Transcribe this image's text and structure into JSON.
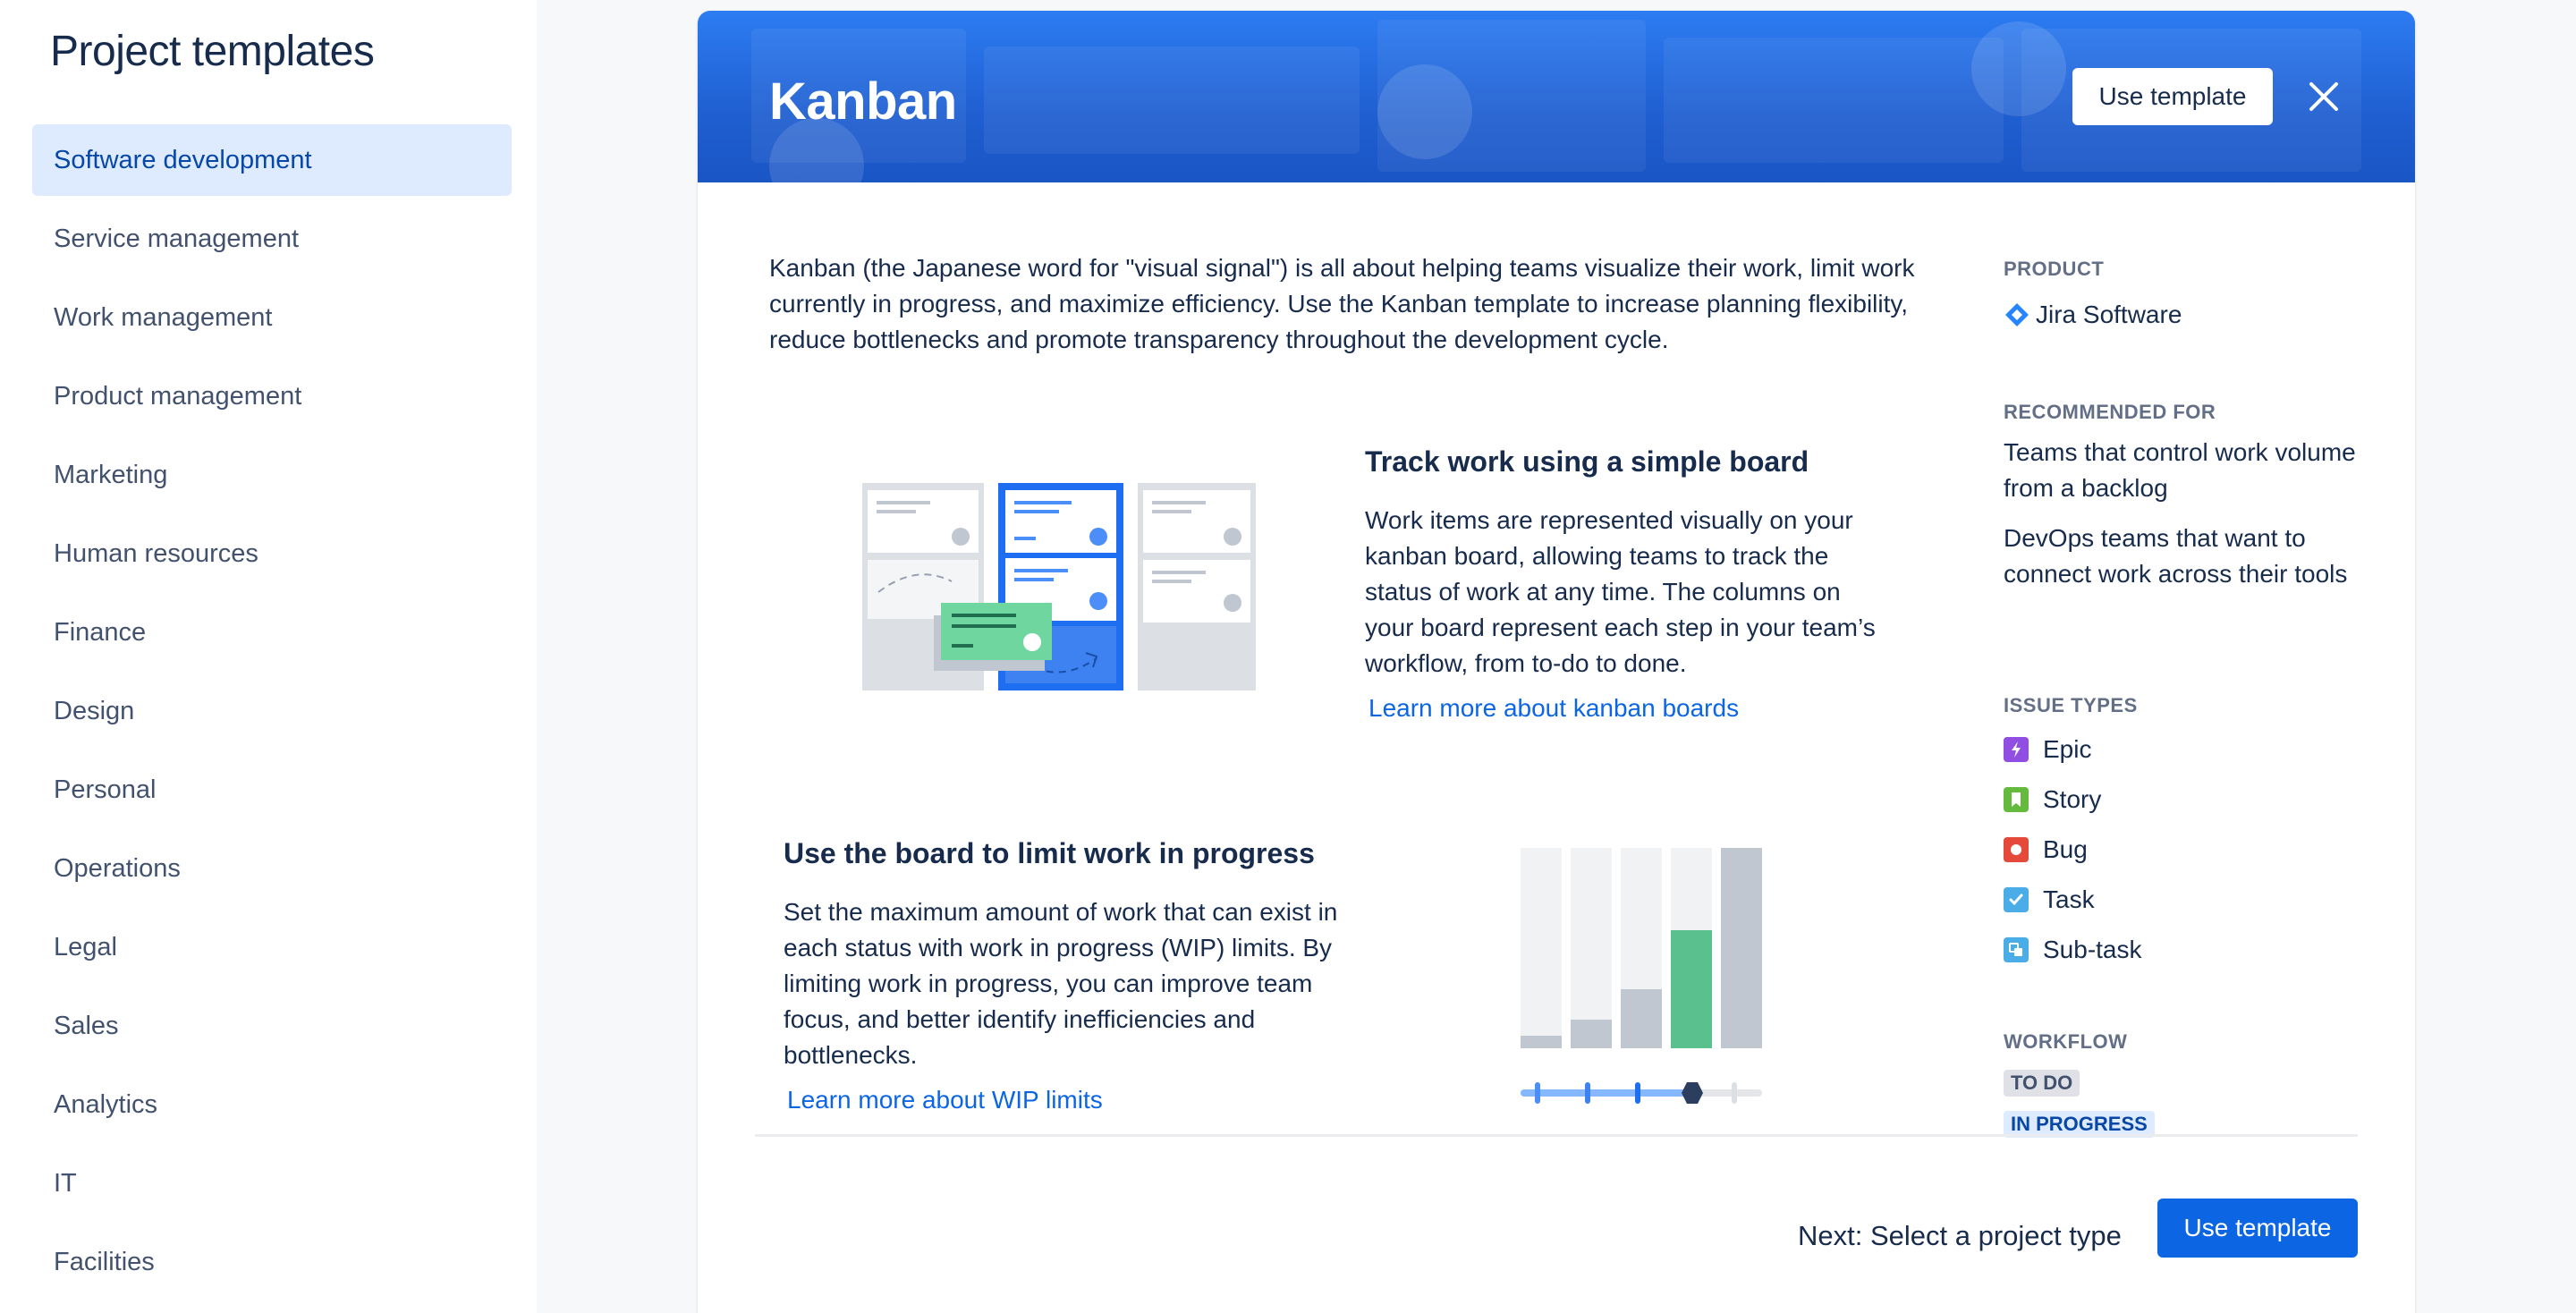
{
  "sidebar": {
    "title": "Project templates",
    "items": [
      {
        "label": "Software development",
        "selected": true
      },
      {
        "label": "Service management"
      },
      {
        "label": "Work management"
      },
      {
        "label": "Product management"
      },
      {
        "label": "Marketing"
      },
      {
        "label": "Human resources"
      },
      {
        "label": "Finance"
      },
      {
        "label": "Design"
      },
      {
        "label": "Personal"
      },
      {
        "label": "Operations"
      },
      {
        "label": "Legal"
      },
      {
        "label": "Sales"
      },
      {
        "label": "Analytics"
      },
      {
        "label": "IT"
      },
      {
        "label": "Facilities"
      }
    ]
  },
  "template": {
    "title": "Kanban",
    "use_template_label": "Use template",
    "close_icon": "close-icon",
    "description": "Kanban (the Japanese word for \"visual signal\") is all about helping teams visualize their work, limit work currently in progress, and maximize efficiency. Use the Kanban template to increase planning flexibility, reduce bottlenecks and promote transparency throughout the development cycle.",
    "sections": [
      {
        "title": "Track work using a simple board",
        "body": "Work items are represented visually on your kanban board, allowing teams to track the status of work at any time. The columns on your board represent each step in your team’s workflow, from to-do to done.",
        "link": "Learn more about kanban boards"
      },
      {
        "title": "Use the board to limit work in progress",
        "body": "Set the maximum amount of work that can exist in each status with work in progress (WIP) limits. By limiting work in progress, you can improve team focus, and better identify inefficiencies and bottlenecks.",
        "link": "Learn more about WIP limits"
      }
    ]
  },
  "details": {
    "product_label": "PRODUCT",
    "product_name": "Jira Software",
    "recommended_label": "RECOMMENDED FOR",
    "recommended": [
      "Teams that control work volume from a backlog",
      "DevOps teams that want to connect work across their tools"
    ],
    "issue_types_label": "ISSUE TYPES",
    "issue_types": [
      {
        "label": "Epic",
        "color": "#904ee2",
        "icon": "epic-icon"
      },
      {
        "label": "Story",
        "color": "#63ba3c",
        "icon": "story-icon"
      },
      {
        "label": "Bug",
        "color": "#e5493a",
        "icon": "bug-icon"
      },
      {
        "label": "Task",
        "color": "#4bade8",
        "icon": "task-icon"
      },
      {
        "label": "Sub-task",
        "color": "#4bade8",
        "icon": "subtask-icon"
      }
    ],
    "workflow_label": "WORKFLOW",
    "workflow": [
      {
        "label": "TO DO",
        "bg": "#dfe1e6",
        "fg": "#42526e"
      },
      {
        "label": "IN PROGRESS",
        "bg": "#deebff",
        "fg": "#0747a6"
      }
    ]
  },
  "footer": {
    "next_text": "Next: Select a project type",
    "use_template_label": "Use template"
  },
  "colors": {
    "accent": "#0c66e4",
    "banner": "#1f5fd1",
    "selected_bg": "#deebff"
  }
}
